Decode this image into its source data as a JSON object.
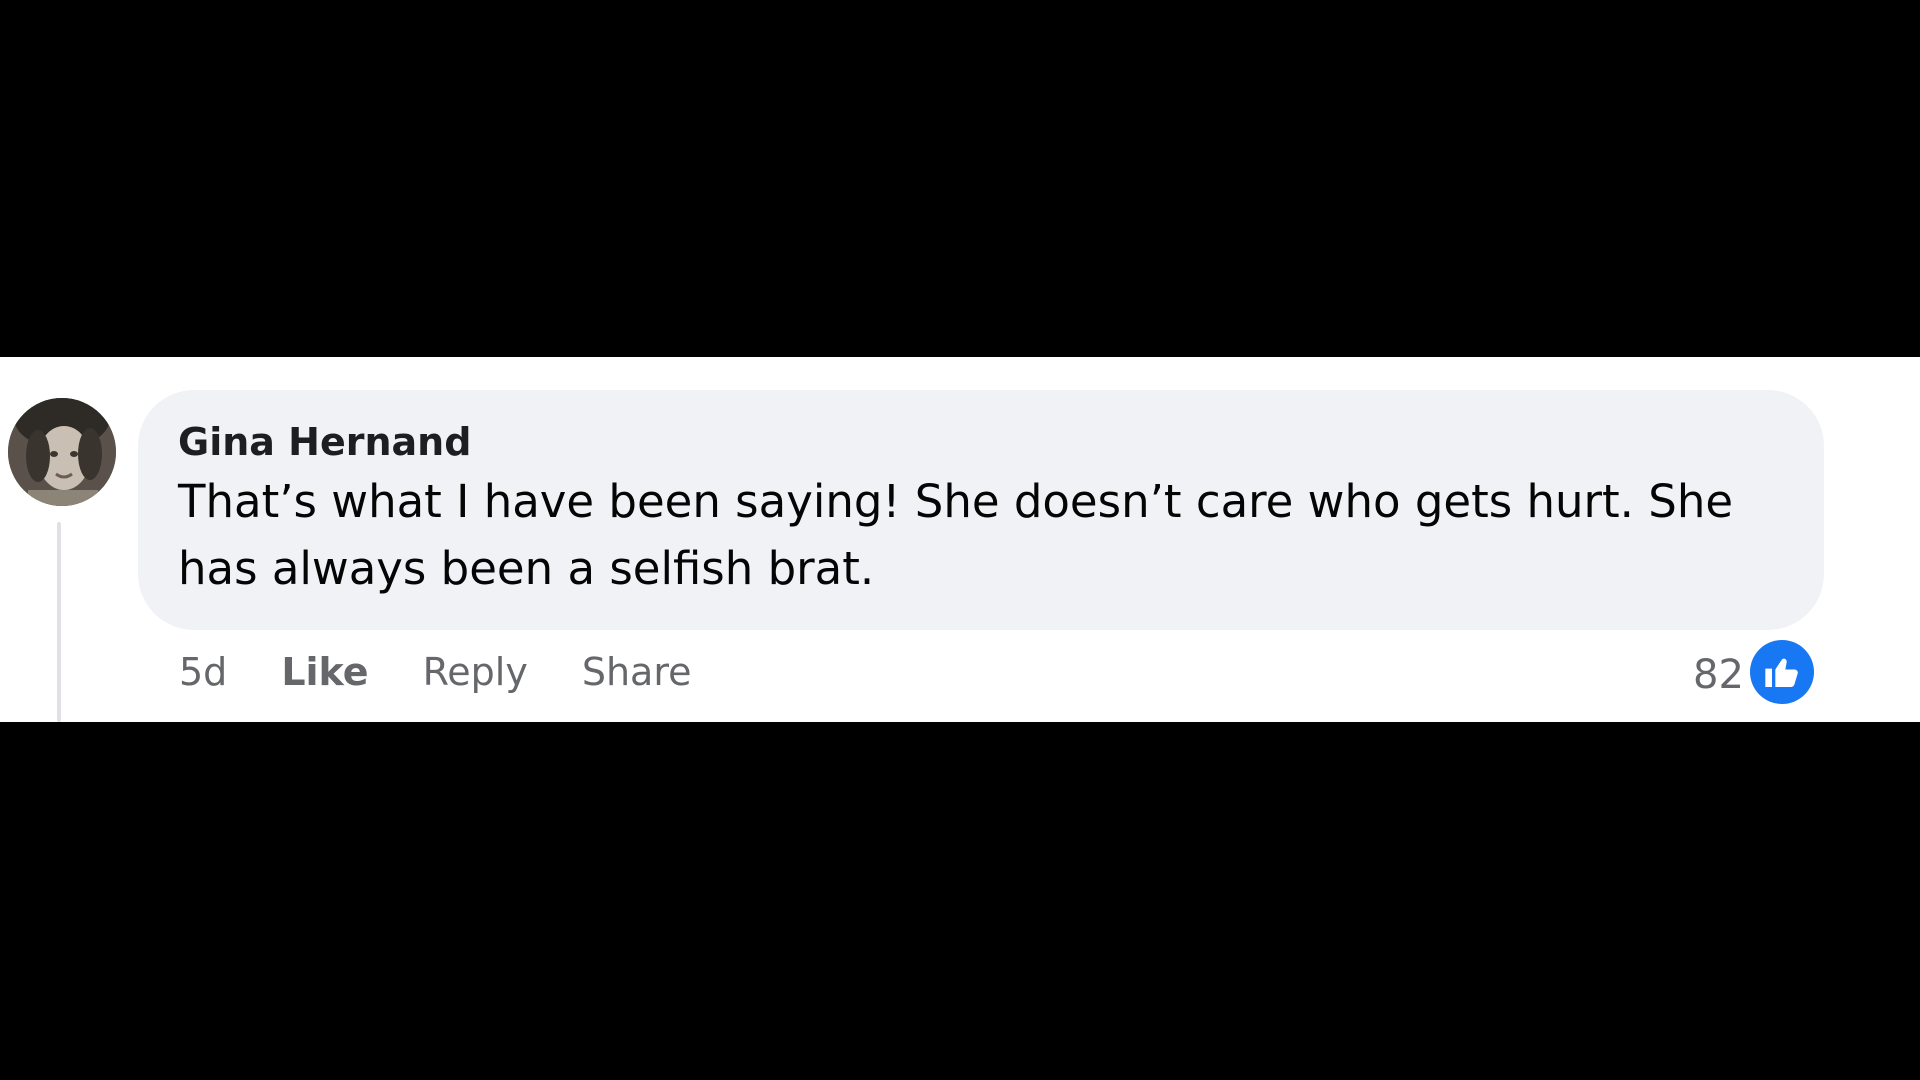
{
  "comment": {
    "author": "Gina Hernand",
    "text": "That’s what I have been saying! She doesn’t care who gets hurt. She has always been a selfish brat.",
    "avatar_icon": "profile-photo",
    "bubble_color": "#f0f2f5"
  },
  "actions": {
    "timestamp": "5d",
    "like_label": "Like",
    "reply_label": "Reply",
    "share_label": "Share"
  },
  "reactions": {
    "count": "82",
    "icon": "thumbs-up-icon",
    "badge_color": "#1877f2"
  }
}
